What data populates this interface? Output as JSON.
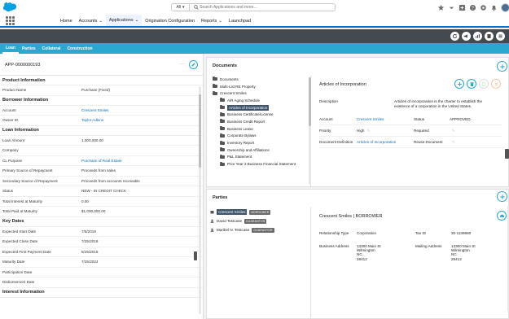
{
  "header": {
    "search_scope": "All",
    "search_placeholder": "Search Applications and more...",
    "icons": [
      "favorites-icon",
      "add-icon",
      "help-icon",
      "settings-icon",
      "notifications-icon"
    ]
  },
  "nav": {
    "items": [
      {
        "label": "Home",
        "dropdown": false,
        "active": false
      },
      {
        "label": "Accounts",
        "dropdown": true,
        "active": false
      },
      {
        "label": "Applications",
        "dropdown": true,
        "active": true
      },
      {
        "label": "Origination Configuration",
        "dropdown": false,
        "active": false
      },
      {
        "label": "Reports",
        "dropdown": true,
        "active": false
      },
      {
        "label": "Launchpad",
        "dropdown": false,
        "active": false
      }
    ]
  },
  "tabs": [
    "Loan",
    "Parties",
    "Collateral",
    "Construction"
  ],
  "left": {
    "app_number": "APP-0000000193",
    "sections": [
      {
        "title": "Product Information",
        "rows": [
          {
            "label": "Product Name",
            "value": "Purchase (Fixed)",
            "link": false
          }
        ]
      },
      {
        "title": "Borrower Information",
        "rows": [
          {
            "label": "Account",
            "value": "Crescent Smiles",
            "link": true
          },
          {
            "label": "Owner ID",
            "value": "Taylor Adkins",
            "link": true
          }
        ]
      },
      {
        "title": "Loan Information",
        "rows": [
          {
            "label": "Loan Amount",
            "value": "1,000,000.00",
            "link": false
          },
          {
            "label": "Company",
            "value": "",
            "link": false
          },
          {
            "label": "CL Purpose",
            "value": "Purchase of Real Estate",
            "link": true
          },
          {
            "label": "Primary Source of Repayment",
            "value": "Proceeds from sales",
            "link": false
          },
          {
            "label": "Secondary Source of Repayment",
            "value": "Proceeds from accounts receivable",
            "link": false
          },
          {
            "label": "Status",
            "value": "NEW - IN CREDIT CHECK",
            "link": false
          },
          {
            "label": "Total Interest at Maturity",
            "value": "0.00",
            "link": false
          },
          {
            "label": "Total Paid at Maturity",
            "value": "$1,000,000.00",
            "link": false
          }
        ]
      },
      {
        "title": "Key Dates",
        "rows": [
          {
            "label": "Expected Start Date",
            "value": "7/5/2018",
            "link": false
          },
          {
            "label": "Expected Close Date",
            "value": "7/25/2018",
            "link": false
          },
          {
            "label": "Expected First Payment Date",
            "value": "8/25/2018",
            "link": false
          },
          {
            "label": "Maturity Date",
            "value": "7/25/2024",
            "link": false
          },
          {
            "label": "Participation Date",
            "value": "",
            "link": false
          },
          {
            "label": "Disbursement Date",
            "value": "",
            "link": false
          }
        ]
      },
      {
        "title": "Interest Information",
        "rows": []
      }
    ]
  },
  "documents": {
    "title": "Documents",
    "tree": [
      {
        "label": "Documents",
        "level": 0,
        "selected": false
      },
      {
        "label": "Multi-List RE Property",
        "level": 0,
        "selected": false
      },
      {
        "label": "Crescent Smiles",
        "level": 0,
        "selected": false
      },
      {
        "label": "A/R Aging Schedule",
        "level": 1,
        "selected": false
      },
      {
        "label": "Articles of Incorporation",
        "level": 1,
        "selected": true
      },
      {
        "label": "Business Certificate/License",
        "level": 1,
        "selected": false
      },
      {
        "label": "Business Credit Report",
        "level": 1,
        "selected": false
      },
      {
        "label": "Business Lease",
        "level": 1,
        "selected": false
      },
      {
        "label": "Corporate Bylaws",
        "level": 1,
        "selected": false
      },
      {
        "label": "Inventory Report",
        "level": 1,
        "selected": false
      },
      {
        "label": "Ownership and Affiliations",
        "level": 1,
        "selected": false
      },
      {
        "label": "P&L Statement",
        "level": 1,
        "selected": false
      },
      {
        "label": "Prior Year 2 Business Financial Statement",
        "level": 1,
        "selected": false
      }
    ],
    "detail": {
      "title": "Articles of Incorporation",
      "description_label": "Description",
      "description": "Articles of incorporation is the charter to establish the existence of a corporation in the United States.",
      "account_label": "Account",
      "account": "Crescent Smiles",
      "status_label": "Status",
      "status": "APPROVED",
      "priority_label": "Priority",
      "priority": "High",
      "required_label": "Required",
      "doc_def_label": "Document Definition",
      "doc_def": "Articles of Incorporation",
      "reuse_label": "Reuse Document"
    }
  },
  "parties": {
    "title": "Parties",
    "list": [
      {
        "name": "Crescent Smiles",
        "badge": "BORROWER",
        "selected": true
      },
      {
        "name": "David Testcase",
        "badge": "GUARANTOR",
        "selected": false
      },
      {
        "name": "Maribel N. Testcase",
        "badge": "GUARANTOR",
        "selected": false
      }
    ],
    "detail": {
      "title": "Crescent Smiles | BORROWER",
      "rel_label": "Relationship Type",
      "rel": "Corporation",
      "tax_label": "Tax ID",
      "tax": "30-1139960",
      "baddr_label": "Business Address",
      "baddr": [
        "13300 Main St",
        "Wilmington",
        "NC",
        "28412"
      ],
      "maddr_label": "Mailing Address",
      "maddr": [
        "13300 Main St",
        "Wilmington",
        "NC",
        "28412"
      ]
    }
  },
  "colors": {
    "brand_blue": "#00a1e0",
    "tab_bar": "#2aa8cf",
    "dark_bar": "#434a52",
    "link": "#0b6fb6",
    "selected_node": "#3d556e"
  }
}
